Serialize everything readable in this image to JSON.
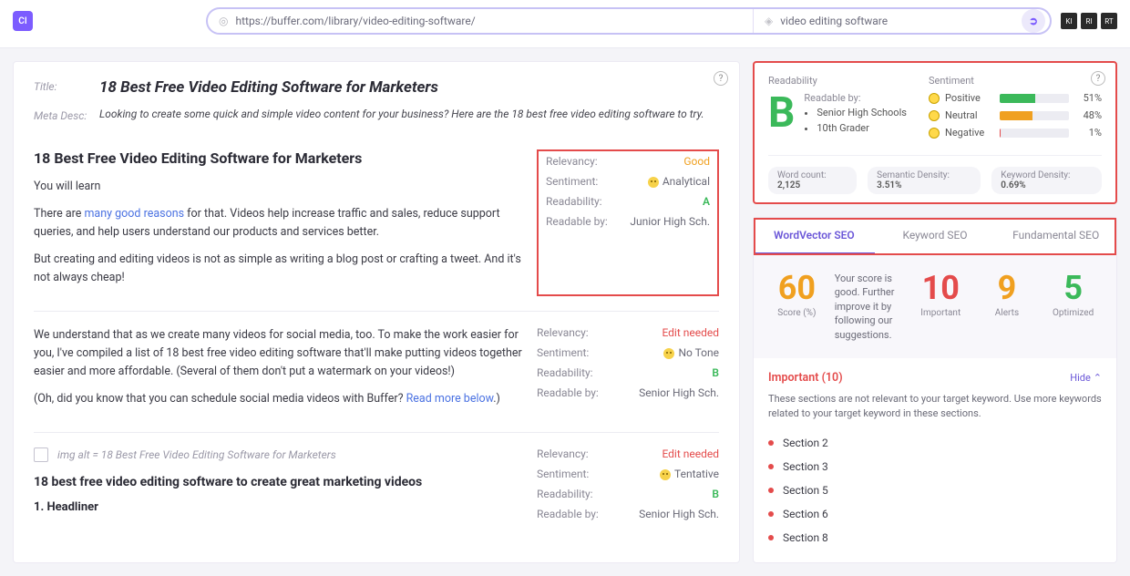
{
  "topbar": {
    "logo": "CI",
    "url": "https://buffer.com/library/video-editing-software/",
    "keyword": "video editing software",
    "right_badges": [
      "KI",
      "RI",
      "RT"
    ]
  },
  "page": {
    "title_label": "Title:",
    "title": "18 Best Free Video Editing Software for Marketers",
    "desc_label": "Meta Desc:",
    "desc": "Looking to create some quick and simple video content for your business? Here are the 18 best free video editing software to try."
  },
  "sections": [
    {
      "heading": "18 Best Free Video Editing Software for Marketers",
      "metrics": {
        "relevancy_lbl": "Relevancy:",
        "relevancy_val": "Good",
        "relevancy_class": "val-good",
        "sentiment_lbl": "Sentiment:",
        "sentiment_val": "Analytical",
        "sentiment_emoji": true,
        "readability_lbl": "Readability:",
        "readability_val": "A",
        "readability_class": "val-green",
        "readable_by_lbl": "Readable by:",
        "readable_by_val": "Junior High Sch."
      },
      "body": {
        "learn": "You will learn",
        "p1a": "There are ",
        "p1link": "many good reasons",
        "p1b": " for that. Videos help increase traffic and sales, reduce support queries, and help users understand our products and services better.",
        "p2": "But creating and editing videos is not as simple as writing a blog post or crafting a tweet. And it's not always cheap!"
      }
    },
    {
      "metrics": {
        "relevancy_lbl": "Relevancy:",
        "relevancy_val": "Edit needed",
        "relevancy_class": "val-editneeded",
        "sentiment_lbl": "Sentiment:",
        "sentiment_val": "No Tone",
        "sentiment_emoji": true,
        "readability_lbl": "Readability:",
        "readability_val": "B",
        "readability_class": "val-green",
        "readable_by_lbl": "Readable by:",
        "readable_by_val": "Senior High Sch."
      },
      "body": {
        "p1": "We understand that as we create many videos for social media, too. To make the work easier for you, I've compiled a list of 18 best free video editing software that'll make putting videos together easier and more affordable. (Several of them don't put a watermark on your videos!)",
        "p2a": "(Oh, did you know that you can schedule social media videos with Buffer? ",
        "p2link": "Read more below",
        "p2b": ".)"
      }
    },
    {
      "metrics": {
        "relevancy_lbl": "Relevancy:",
        "relevancy_val": "Edit needed",
        "relevancy_class": "val-editneeded",
        "sentiment_lbl": "Sentiment:",
        "sentiment_val": "Tentative",
        "sentiment_emoji": true,
        "readability_lbl": "Readability:",
        "readability_val": "B",
        "readability_class": "val-green",
        "readable_by_lbl": "Readable by:",
        "readable_by_val": "Senior High Sch."
      },
      "body": {
        "img_alt": "img alt = 18 Best Free Video Editing Software for Marketers",
        "subhead": "18 best free video editing software to create great marketing videos",
        "h1": "1. Headliner"
      }
    }
  ],
  "readability": {
    "title": "Readability",
    "grade": "B",
    "readable_by_lbl": "Readable by:",
    "list": [
      "Senior High Schools",
      "10th Grader"
    ]
  },
  "sentiment": {
    "title": "Sentiment",
    "rows": [
      {
        "label": "Positive",
        "value": "51%",
        "pct": 51,
        "color": "#3bb95a"
      },
      {
        "label": "Neutral",
        "value": "48%",
        "pct": 48,
        "color": "#f0a020"
      },
      {
        "label": "Negative",
        "value": "1%",
        "pct": 1,
        "color": "#e44b4b"
      }
    ]
  },
  "stats": {
    "word_count_lbl": "Word count:",
    "word_count": "2,125",
    "sem_density_lbl": "Semantic Density:",
    "sem_density": "3.51%",
    "kw_density_lbl": "Keyword Density:",
    "kw_density": "0.69%"
  },
  "tabs": {
    "a": "WordVector SEO",
    "b": "Keyword SEO",
    "c": "Fundamental SEO"
  },
  "scores": {
    "score_val": "60",
    "score_lbl": "Score (%)",
    "score_text": "Your score is good. Further improve it by following our suggestions.",
    "important_val": "10",
    "important_lbl": "Important",
    "alerts_val": "9",
    "alerts_lbl": "Alerts",
    "optimized_val": "5",
    "optimized_lbl": "Optimized"
  },
  "issues": {
    "title": "Important (10)",
    "hide": "Hide",
    "desc": "These sections are not relevant to your target keyword. Use more keywords related to your target keyword in these sections.",
    "items": [
      "Section 2",
      "Section 3",
      "Section 5",
      "Section 6",
      "Section 8"
    ]
  }
}
